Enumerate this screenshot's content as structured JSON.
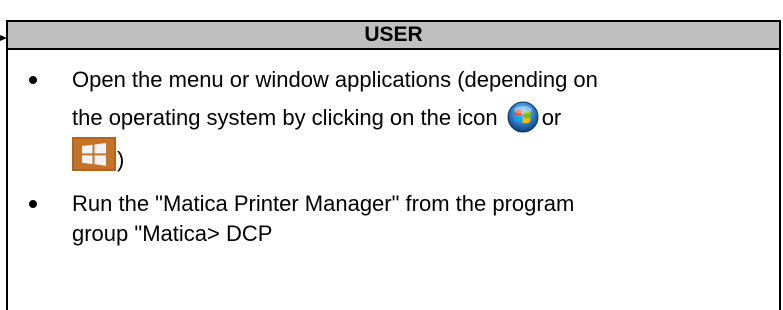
{
  "panel": {
    "header": "USER"
  },
  "steps": [
    {
      "text_line_1": "Open the menu or window applications (depending on",
      "text_line_2": "the operating system by clicking on the icon",
      "connector": "or",
      "closing": ")",
      "icons": [
        "windows-7-start-orb-icon",
        "windows-8-tile-icon"
      ]
    },
    {
      "text_line_1": "Run the \"Matica Printer Manager\" from the program",
      "text_line_2": "group \"Matica> DCP"
    }
  ],
  "colors": {
    "header_background": "#bfbfbf",
    "border": "#000000",
    "win8_tile": "#b0641c",
    "win7_orb": "#2b78c4"
  }
}
